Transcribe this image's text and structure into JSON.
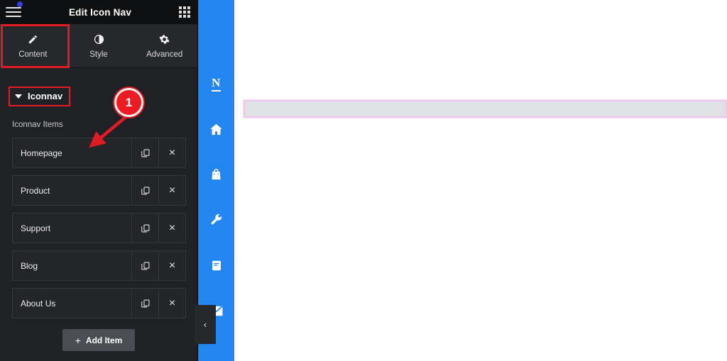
{
  "panel": {
    "header": {
      "title": "Edit Icon Nav",
      "menu_icon": "hamburger-icon",
      "notification_dot": "blue",
      "apps_icon": "apps-grid-icon"
    },
    "tabs": [
      {
        "label": "Content",
        "icon": "pencil-icon",
        "active": true
      },
      {
        "label": "Style",
        "icon": "contrast-icon",
        "active": false
      },
      {
        "label": "Advanced",
        "icon": "gear-icon",
        "active": false
      }
    ],
    "section": {
      "title": "Iconnav",
      "collapsed": false,
      "caret_icon": "caret-down-icon"
    },
    "items_label": "Iconnav Items",
    "items": [
      {
        "title": "Homepage",
        "duplicate_icon": "copy-icon",
        "remove_icon": "close-icon"
      },
      {
        "title": "Product",
        "duplicate_icon": "copy-icon",
        "remove_icon": "close-icon"
      },
      {
        "title": "Support",
        "duplicate_icon": "copy-icon",
        "remove_icon": "close-icon"
      },
      {
        "title": "Blog",
        "duplicate_icon": "copy-icon",
        "remove_icon": "close-icon"
      },
      {
        "title": "About Us",
        "duplicate_icon": "copy-icon",
        "remove_icon": "close-icon"
      }
    ],
    "add_item": {
      "label": "Add Item",
      "plus": "+"
    }
  },
  "iconnav_preview": {
    "background_color": "#2386f0",
    "items": [
      {
        "icon": "letter-n-icon",
        "label": "N"
      },
      {
        "icon": "home-icon"
      },
      {
        "icon": "shopping-bag-icon"
      },
      {
        "icon": "wrench-icon"
      },
      {
        "icon": "book-icon"
      },
      {
        "icon": "envelope-icon"
      }
    ]
  },
  "collapse_handle": {
    "icon": "chevron-left-icon",
    "glyph": "‹"
  },
  "canvas": {
    "placeholder": {
      "border_color": "#eec6ef",
      "fill_color": "#dfe1e2"
    }
  },
  "annotations": {
    "badge_number": "1",
    "tab_highlight_color": "#e01b24",
    "section_highlight_color": "#e01b24",
    "arrow_color": "#e01b24"
  }
}
